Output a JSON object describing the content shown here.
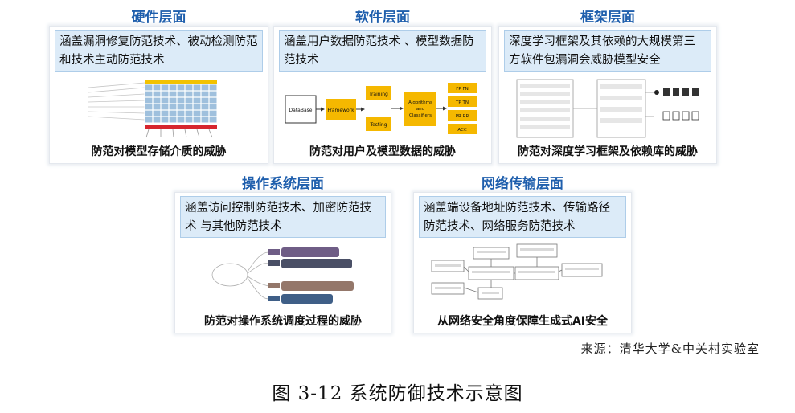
{
  "hardware": {
    "title": "硬件层面",
    "desc": "涵盖漏洞修复防范技术、被动检测防范和技术主动防范技术",
    "caption": "防范对模型存储介质的威胁"
  },
  "software": {
    "title": "软件层面",
    "desc": "涵盖用户数据防范技术 、模型数据防范技术",
    "caption": "防范对用户及模型数据的威胁",
    "diagram": {
      "database": "DataBase",
      "framework": "Framework",
      "training": "Training",
      "testing": "Testing",
      "algorithms": [
        "Algorithms",
        "and",
        "Classifiers"
      ],
      "metrics": [
        "FP FN",
        "TP TN",
        "PR RR",
        "ACC"
      ]
    }
  },
  "framework": {
    "title": "框架层面",
    "desc": "深度学习框架及其依赖的大规模第三方软件包漏洞会威胁模型安全",
    "caption": "防范对深度学习框架及依赖库的威胁"
  },
  "os": {
    "title": "操作系统层面",
    "desc": "涵盖访问控制防范技术、加密防范技术 与其他防范技术",
    "caption": "防范对操作系统调度过程的威胁"
  },
  "network": {
    "title": "网络传输层面",
    "desc": "涵盖端设备地址防范技术、传输路径防范技术、网络服务防范技术",
    "caption": "从网络安全角度保障生成式AI安全"
  },
  "source": "来源：清华大学&中关村实验室",
  "figure_title": "图 3-12 系统防御技术示意图",
  "colors": {
    "title_blue": "#1f5fad",
    "desc_bg": "#dcebf8",
    "flow_yellow": "#f5b800"
  }
}
